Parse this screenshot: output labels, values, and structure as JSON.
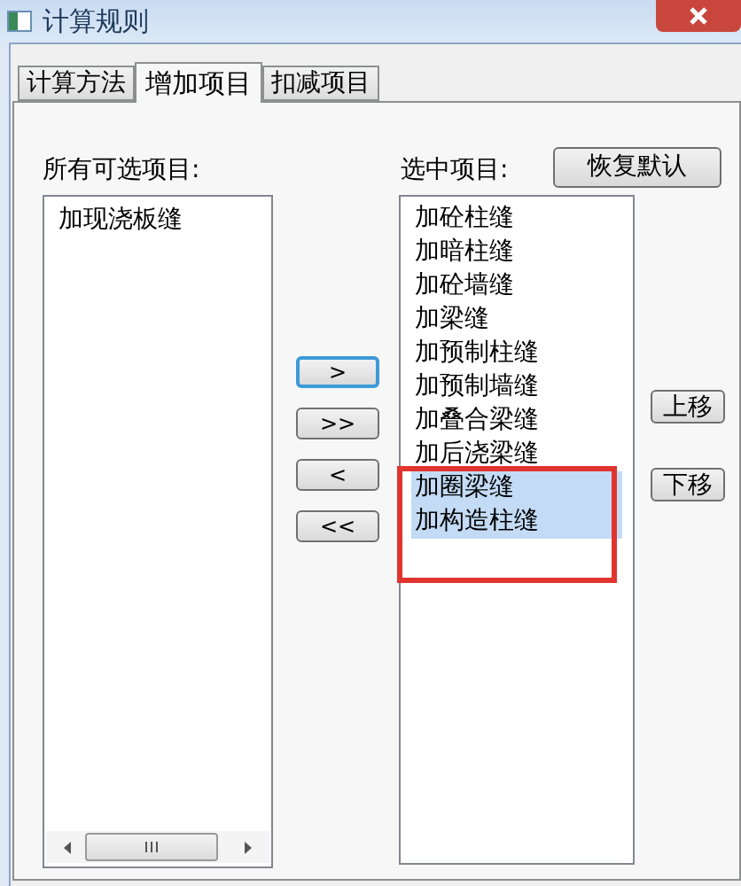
{
  "window": {
    "title": "计算规则"
  },
  "tabs": [
    {
      "label": "计算方法",
      "selected": false
    },
    {
      "label": "增加项目",
      "selected": true
    },
    {
      "label": "扣减项目",
      "selected": false
    }
  ],
  "available": {
    "label": "所有可选项目:",
    "items": [
      {
        "text": "加现浇板缝",
        "selected": false
      }
    ]
  },
  "chosen": {
    "label": "选中项目:",
    "items": [
      {
        "text": "加砼柱缝",
        "selected": false,
        "annotated": false
      },
      {
        "text": "加暗柱缝",
        "selected": false,
        "annotated": false
      },
      {
        "text": "加砼墙缝",
        "selected": false,
        "annotated": false
      },
      {
        "text": "加梁缝",
        "selected": false,
        "annotated": false
      },
      {
        "text": "加预制柱缝",
        "selected": false,
        "annotated": false
      },
      {
        "text": "加预制墙缝",
        "selected": false,
        "annotated": false
      },
      {
        "text": "加叠合梁缝",
        "selected": false,
        "annotated": false
      },
      {
        "text": "加后浇梁缝",
        "selected": false,
        "annotated": false
      },
      {
        "text": "加圈梁缝",
        "selected": true,
        "annotated": true
      },
      {
        "text": "加构造柱缝",
        "selected": true,
        "annotated": true
      }
    ]
  },
  "restore_button": "恢复默认",
  "transfer_buttons": [
    {
      "label": ">",
      "focused": true
    },
    {
      "label": ">>",
      "focused": false
    },
    {
      "label": "<",
      "focused": false
    },
    {
      "label": "<<",
      "focused": false
    }
  ],
  "order_buttons": [
    "上移",
    "下移"
  ]
}
